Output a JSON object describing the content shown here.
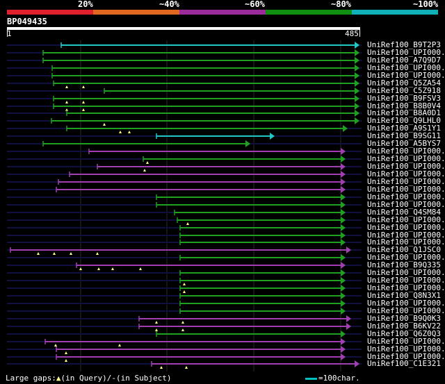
{
  "scale": {
    "labels": [
      "20%",
      "~40%",
      "~60%",
      "~80%",
      "~100%"
    ],
    "colors": [
      "#e0202c",
      "#e06820",
      "#9c2c9c",
      "#109010",
      "#10b0b8"
    ]
  },
  "query": {
    "name": "BP049435",
    "start": "1",
    "end": "485"
  },
  "colors": {
    "cyan": "#20c8c8",
    "green": "#20a020",
    "purple": "#a040b0",
    "dark": "#101040",
    "marker": "#ffff88"
  },
  "hits": [
    {
      "name": "UniRef100_B9T2P3",
      "color": "cyan",
      "s": 88,
      "e": 517,
      "m": []
    },
    {
      "name": "UniRef100_UPI000..",
      "color": "green",
      "s": 62,
      "e": 517,
      "m": []
    },
    {
      "name": "UniRef100_A7Q9D7",
      "color": "green",
      "s": 62,
      "e": 517,
      "m": []
    },
    {
      "name": "UniRef100_UPI000..",
      "color": "green",
      "s": 75,
      "e": 517,
      "m": []
    },
    {
      "name": "UniRef100_UPI000..",
      "color": "green",
      "s": 75,
      "e": 517,
      "m": []
    },
    {
      "name": "UniRef100_Q5ZA54",
      "color": "green",
      "s": 77,
      "e": 517,
      "m": [
        96,
        120
      ]
    },
    {
      "name": "UniRef100_C5Z918",
      "color": "green",
      "s": 150,
      "e": 517,
      "m": []
    },
    {
      "name": "UniRef100_B9FSV3",
      "color": "green",
      "s": 77,
      "e": 517,
      "m": [
        96,
        120
      ]
    },
    {
      "name": "UniRef100_B8B0V4",
      "color": "green",
      "s": 77,
      "e": 517,
      "m": [
        96,
        120
      ]
    },
    {
      "name": "UniRef100_B8A0D1",
      "color": "green",
      "s": 96,
      "e": 517,
      "m": []
    },
    {
      "name": "UniRef100_Q9LHL0",
      "color": "green",
      "s": 74,
      "e": 517,
      "m": [
        150
      ]
    },
    {
      "name": "UniRef100_A9S1Y1",
      "color": "green",
      "s": 96,
      "e": 500,
      "m": [
        173,
        186
      ]
    },
    {
      "name": "UniRef100_B9SG11",
      "color": "cyan",
      "s": 225,
      "e": 395,
      "m": []
    },
    {
      "name": "UniRef100_A5BYS7",
      "color": "green",
      "s": 62,
      "e": 360,
      "m": []
    },
    {
      "name": "UniRef100_UPI000..",
      "color": "purple",
      "s": 128,
      "e": 497,
      "m": []
    },
    {
      "name": "UniRef100_UPI000..",
      "color": "green",
      "s": 206,
      "e": 497,
      "m": [
        212
      ]
    },
    {
      "name": "UniRef100_UPI000..",
      "color": "purple",
      "s": 140,
      "e": 497,
      "m": [
        208
      ]
    },
    {
      "name": "UniRef100_UPI000..",
      "color": "purple",
      "s": 100,
      "e": 497,
      "m": []
    },
    {
      "name": "UniRef100_UPI000..",
      "color": "purple",
      "s": 84,
      "e": 497,
      "m": []
    },
    {
      "name": "UniRef100_UPI000..",
      "color": "purple",
      "s": 81,
      "e": 497,
      "m": []
    },
    {
      "name": "UniRef100_UPI000..",
      "color": "green",
      "s": 225,
      "e": 497,
      "m": []
    },
    {
      "name": "UniRef100_UPI000..",
      "color": "green",
      "s": 225,
      "e": 497,
      "m": []
    },
    {
      "name": "UniRef100_Q4SM84",
      "color": "green",
      "s": 251,
      "e": 497,
      "m": []
    },
    {
      "name": "UniRef100_UPI000..",
      "color": "green",
      "s": 255,
      "e": 497,
      "m": [
        270
      ]
    },
    {
      "name": "UniRef100_UPI000..",
      "color": "green",
      "s": 259,
      "e": 497,
      "m": []
    },
    {
      "name": "UniRef100_UPI000..",
      "color": "green",
      "s": 259,
      "e": 497,
      "m": []
    },
    {
      "name": "UniRef100_UPI000..",
      "color": "green",
      "s": 259,
      "e": 497,
      "m": []
    },
    {
      "name": "UniRef100_Q1JSC0",
      "color": "purple",
      "s": 15,
      "e": 505,
      "m": [
        55,
        78,
        102,
        140
      ]
    },
    {
      "name": "UniRef100_UPI000..",
      "color": "green",
      "s": 259,
      "e": 497,
      "m": []
    },
    {
      "name": "UniRef100_B9Q335",
      "color": "purple",
      "s": 110,
      "e": 497,
      "m": [
        116,
        142,
        162,
        202
      ]
    },
    {
      "name": "UniRef100_UPI000..",
      "color": "green",
      "s": 259,
      "e": 497,
      "m": []
    },
    {
      "name": "UniRef100_UPI000..",
      "color": "green",
      "s": 259,
      "e": 497,
      "m": [
        265
      ]
    },
    {
      "name": "UniRef100_UPI000..",
      "color": "green",
      "s": 259,
      "e": 497,
      "m": [
        265
      ]
    },
    {
      "name": "UniRef100_Q8N3X1",
      "color": "green",
      "s": 259,
      "e": 497,
      "m": []
    },
    {
      "name": "UniRef100_UPI000..",
      "color": "green",
      "s": 259,
      "e": 497,
      "m": []
    },
    {
      "name": "UniRef100_UPI000..",
      "color": "green",
      "s": 259,
      "e": 497,
      "m": []
    },
    {
      "name": "UniRef100_B9Q0K3",
      "color": "purple",
      "s": 200,
      "e": 505,
      "m": [
        225,
        263
      ]
    },
    {
      "name": "UniRef100_B6KV22",
      "color": "purple",
      "s": 200,
      "e": 505,
      "m": [
        225,
        263
      ]
    },
    {
      "name": "UniRef100_Q6Z0Q3",
      "color": "green",
      "s": 225,
      "e": 497,
      "m": []
    },
    {
      "name": "UniRef100_UPI000..",
      "color": "purple",
      "s": 65,
      "e": 497,
      "m": [
        80,
        172
      ]
    },
    {
      "name": "UniRef100_UPI000..",
      "color": "purple",
      "s": 81,
      "e": 497,
      "m": [
        95
      ]
    },
    {
      "name": "UniRef100_UPI000..",
      "color": "purple",
      "s": 81,
      "e": 497,
      "m": [
        95
      ]
    },
    {
      "name": "UniRef100_C1E321",
      "color": "purple",
      "s": 218,
      "e": 517,
      "m": [
        232,
        268
      ]
    }
  ],
  "footer": {
    "large_gaps": "Large gaps:",
    "in_query_marker": "▲",
    "in_query": "(in Query)/-",
    "in_subject": "(in Subject)",
    "legend": "=100char."
  }
}
